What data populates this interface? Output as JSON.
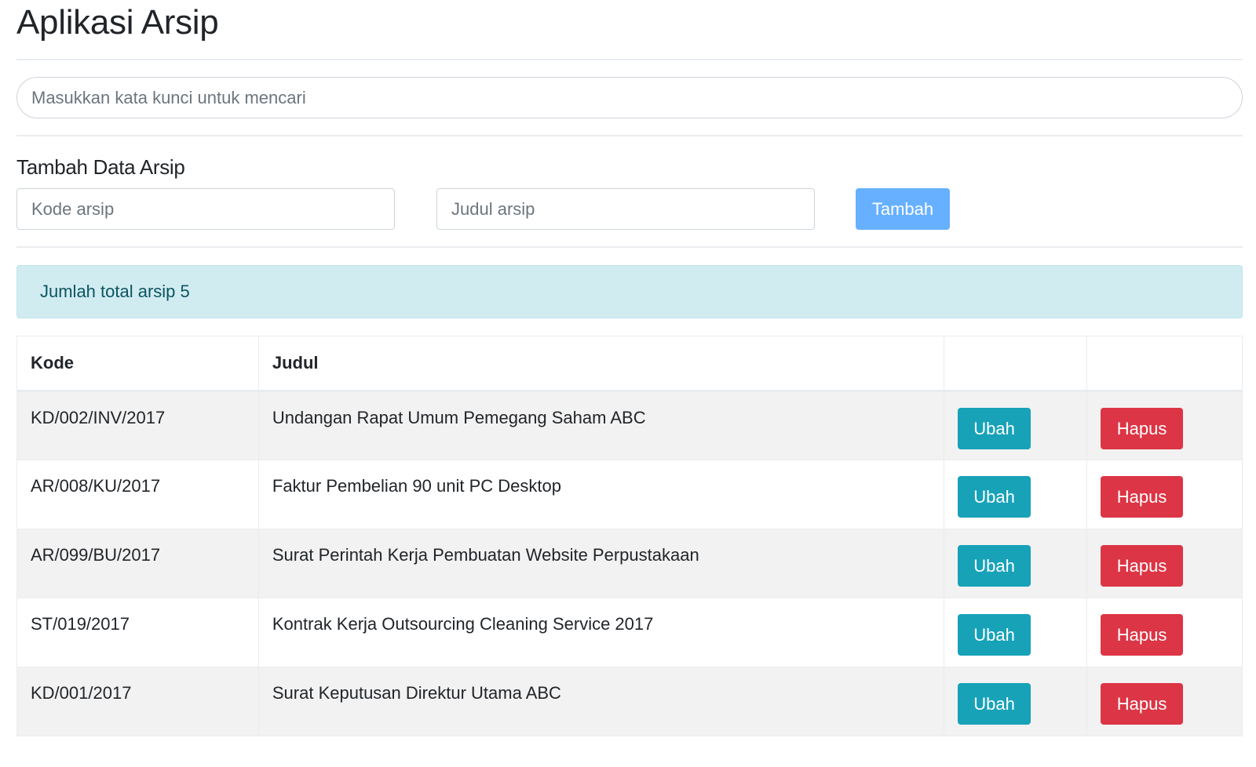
{
  "app": {
    "title": "Aplikasi Arsip"
  },
  "search": {
    "placeholder": "Masukkan kata kunci untuk mencari",
    "value": ""
  },
  "form": {
    "title": "Tambah Data Arsip",
    "kode_placeholder": "Kode arsip",
    "judul_placeholder": "Judul arsip",
    "submit_label": "Tambah",
    "submit_color": "#66b0ff"
  },
  "summary": {
    "text": "Jumlah total arsip 5",
    "count": 5
  },
  "table": {
    "headers": [
      "Kode",
      "Judul",
      "",
      ""
    ],
    "rows": [
      {
        "kode": "KD/002/INV/2017",
        "judul": "Undangan Rapat Umum Pemegang Saham ABC",
        "edit_label": "Ubah",
        "delete_label": "Hapus"
      },
      {
        "kode": "AR/008/KU/2017",
        "judul": "Faktur Pembelian 90 unit PC Desktop",
        "edit_label": "Ubah",
        "delete_label": "Hapus"
      },
      {
        "kode": "AR/099/BU/2017",
        "judul": "Surat Perintah Kerja Pembuatan Website Perpustakaan",
        "edit_label": "Ubah",
        "delete_label": "Hapus"
      },
      {
        "kode": "ST/019/2017",
        "judul": "Kontrak Kerja Outsourcing Cleaning Service 2017",
        "edit_label": "Ubah",
        "delete_label": "Hapus"
      },
      {
        "kode": "KD/001/2017",
        "judul": "Surat Keputusan Direktur Utama ABC",
        "edit_label": "Ubah",
        "delete_label": "Hapus"
      }
    ]
  },
  "colors": {
    "edit_button": "#17a2b8",
    "delete_button": "#dc3545",
    "alert_background": "#d1ecf1",
    "alert_text": "#0c5460"
  }
}
